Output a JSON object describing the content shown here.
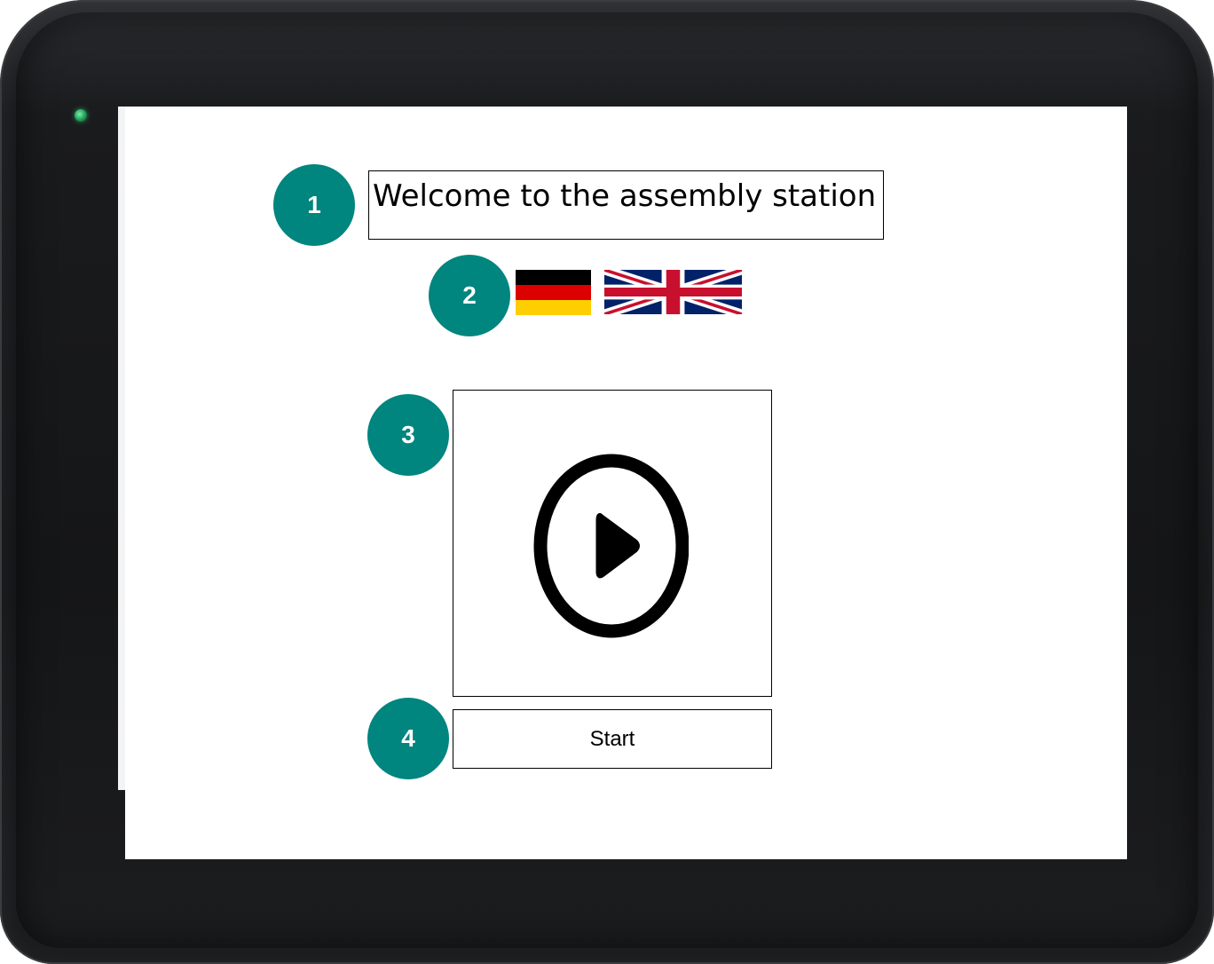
{
  "title": "Welcome to the assembly station",
  "markers": [
    "1",
    "2",
    "3",
    "4"
  ],
  "languages": [
    {
      "name": "German",
      "icon": "german-flag-icon"
    },
    {
      "name": "English",
      "icon": "uk-flag-icon"
    }
  ],
  "video": {
    "icon": "play-icon"
  },
  "start_button": {
    "label": "Start"
  },
  "colors": {
    "marker": "#00857f",
    "bezel": "#1a1b1d",
    "led": "#1f9a55",
    "flag_de": [
      "#000000",
      "#dd0000",
      "#ffce00"
    ],
    "flag_uk": [
      "#012169",
      "#ffffff",
      "#c8102e"
    ]
  }
}
